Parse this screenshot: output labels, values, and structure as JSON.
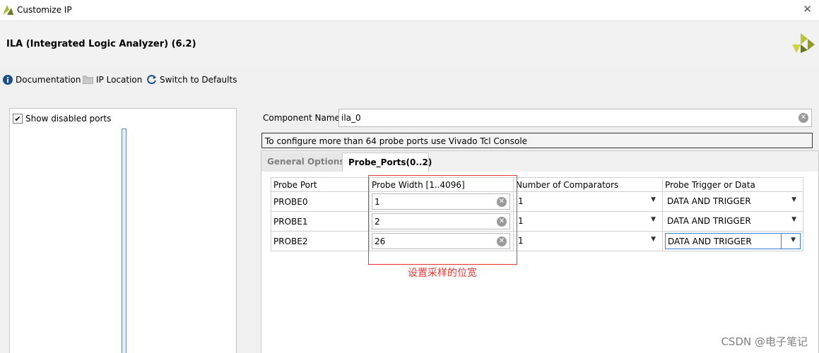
{
  "window": {
    "title": "Customize IP"
  },
  "header": {
    "ip_title": "ILA (Integrated Logic Analyzer) (6.2)"
  },
  "toolbar": {
    "documentation": "Documentation",
    "ip_location": "IP Location",
    "switch_defaults": "Switch to Defaults"
  },
  "left_panel": {
    "show_disabled_ports": "Show disabled ports",
    "checked": true
  },
  "component": {
    "label": "Component Name",
    "value": "ila_0"
  },
  "note": "To configure more than 64 probe ports use Vivado Tcl Console",
  "tabs": [
    {
      "label": "General Options",
      "active": false
    },
    {
      "label": "Probe_Ports(0..2)",
      "active": true
    }
  ],
  "probe_table": {
    "headers": [
      "Probe Port",
      "Probe Width [1..4096]",
      "Number of Comparators",
      "Probe Trigger or Data"
    ],
    "rows": [
      {
        "port": "PROBE0",
        "width": "1",
        "comparators": "1",
        "trigger": "DATA AND TRIGGER"
      },
      {
        "port": "PROBE1",
        "width": "2",
        "comparators": "1",
        "trigger": "DATA AND TRIGGER"
      },
      {
        "port": "PROBE2",
        "width": "26",
        "comparators": "1",
        "trigger": "DATA AND TRIGGER"
      }
    ]
  },
  "annotation": {
    "text": "设置采样的位宽",
    "color": "#e53935"
  },
  "watermark": "CSDN @电子笔记"
}
